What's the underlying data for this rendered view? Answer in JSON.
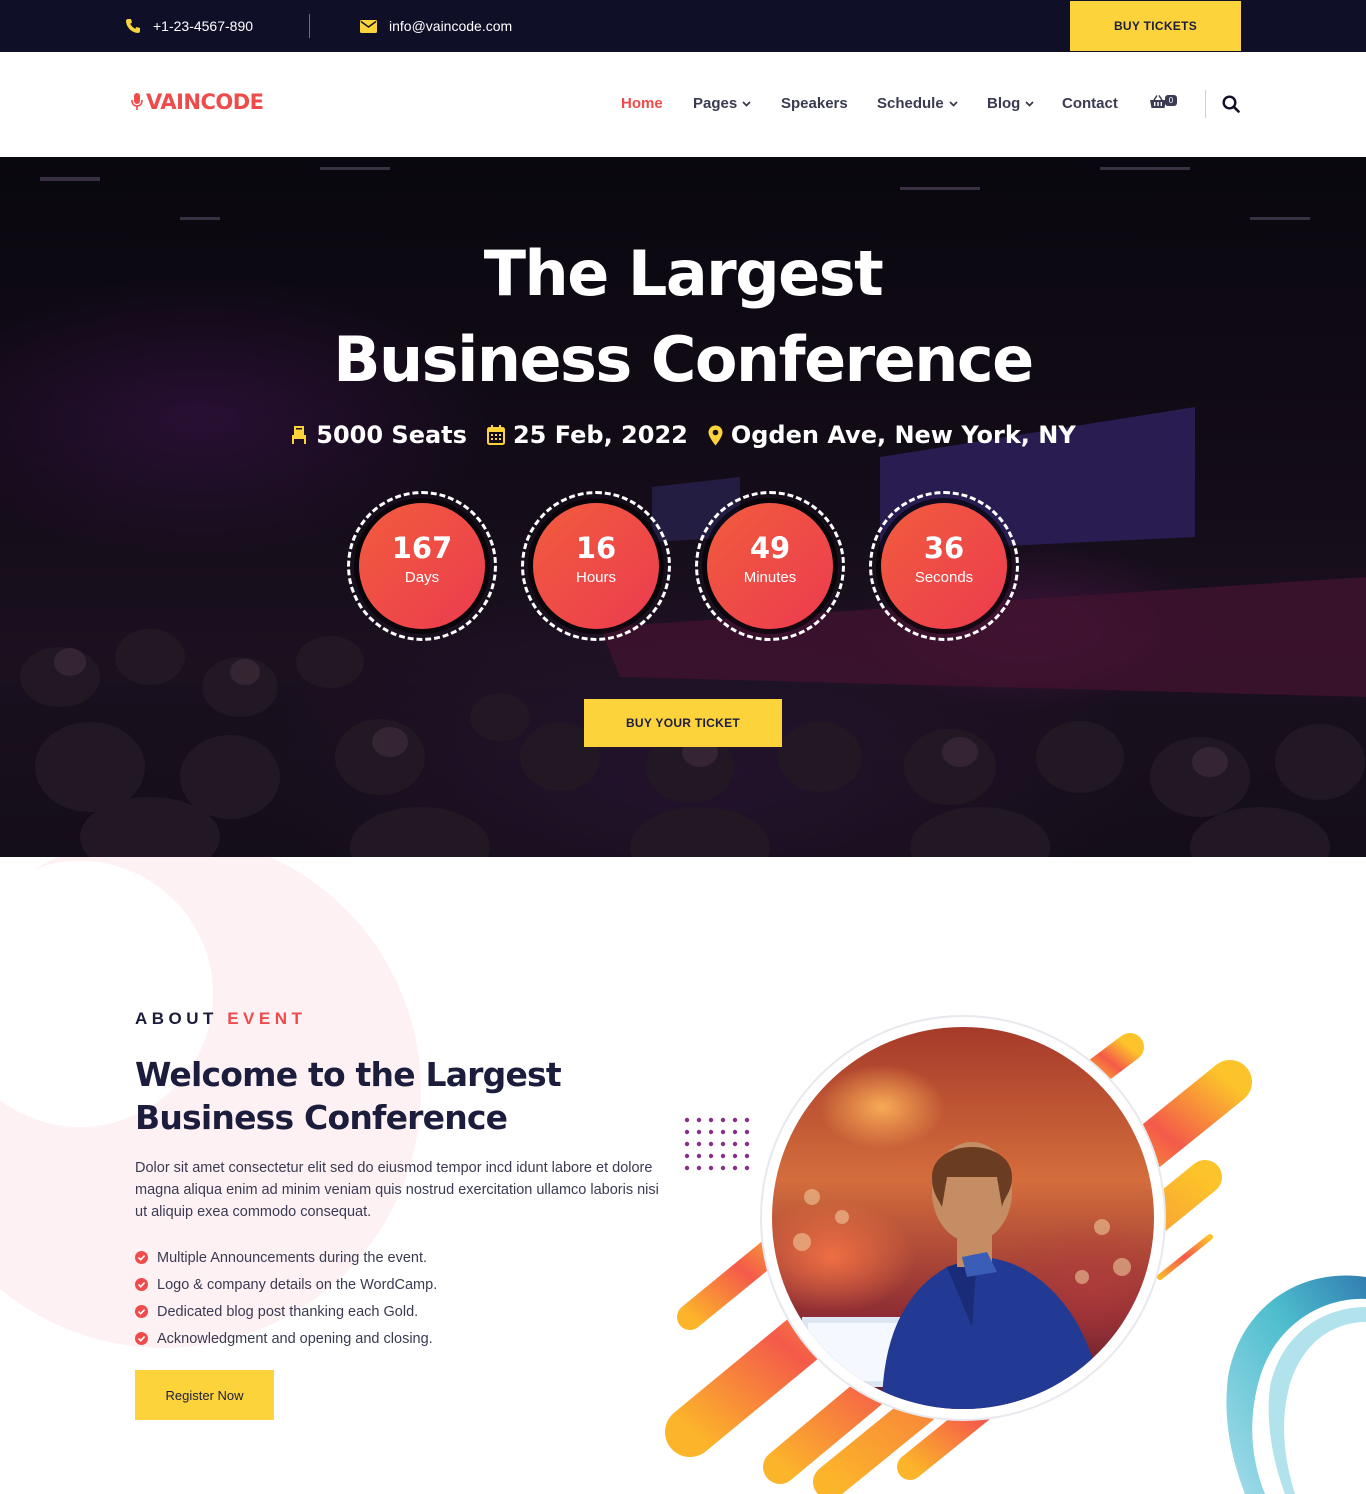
{
  "topbar": {
    "phone": "+1-23-4567-890",
    "email": "info@vaincode.com",
    "buy_button": "BUY TICKETS"
  },
  "brand": {
    "logo_text": "VAINCODE"
  },
  "nav": {
    "items": [
      {
        "label": "Home",
        "active": true
      },
      {
        "label": "Pages",
        "dropdown": true
      },
      {
        "label": "Speakers"
      },
      {
        "label": "Schedule",
        "dropdown": true
      },
      {
        "label": "Blog",
        "dropdown": true
      },
      {
        "label": "Contact"
      }
    ],
    "cart_count": "0"
  },
  "hero": {
    "title_line1": "The Largest",
    "title_line2": "Business Conference",
    "seats": "5000 Seats",
    "date": "25 Feb, 2022",
    "location": "Ogden Ave, New York, NY",
    "countdown": [
      {
        "value": "167",
        "label": "Days"
      },
      {
        "value": "16",
        "label": "Hours"
      },
      {
        "value": "49",
        "label": "Minutes"
      },
      {
        "value": "36",
        "label": "Seconds"
      }
    ],
    "cta": "BUY YOUR TICKET"
  },
  "about": {
    "subtitle_a": "ABOUT",
    "subtitle_b": "EVENT",
    "title": "Welcome to the Largest Business Conference",
    "text": "Dolor sit amet consectetur elit sed do eiusmod tempor incd idunt labore et dolore magna aliqua enim ad minim veniam quis nostrud exercitation ullamco laboris nisi ut aliquip exea commodo consequat.",
    "features": [
      "Multiple Announcements during the event.",
      "Logo & company details on the WordCamp.",
      "Dedicated blog post thanking each Gold.",
      "Acknowledgment and opening and closing."
    ],
    "register_button": "Register Now"
  },
  "colors": {
    "accent": "#ef4b4b",
    "yellow": "#fcd33b",
    "dark": "#0f1028",
    "heading": "#1c1d3c"
  },
  "icons": {
    "phone": "phone-icon",
    "email": "envelope-icon",
    "cart": "basket-icon",
    "search": "search-icon",
    "seats": "chair-icon",
    "date": "calendar-icon",
    "location": "map-pin-icon",
    "check": "check-circle-icon",
    "logo": "microphone-icon"
  }
}
